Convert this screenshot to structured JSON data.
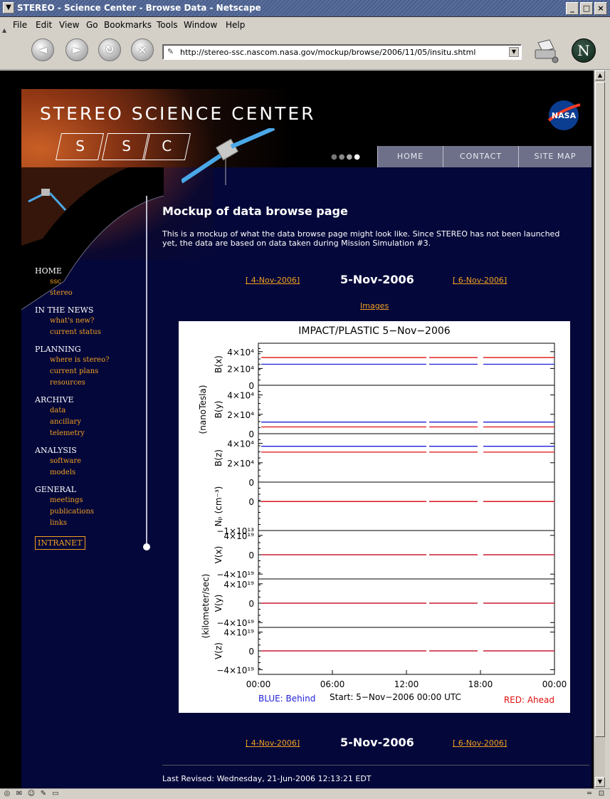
{
  "window": {
    "title": "STEREO - Science Center - Browse Data - Netscape"
  },
  "menu": [
    "File",
    "Edit",
    "View",
    "Go",
    "Bookmarks",
    "Tools",
    "Window",
    "Help"
  ],
  "toolbar": {
    "url": "http://stereo-ssc.nascom.nasa.gov/mockup/browse/2006/11/05/insitu.shtml"
  },
  "banner": {
    "title": "STEREO SCIENCE CENTER",
    "letters": [
      "S",
      "S",
      "C"
    ],
    "nasa": "NASA",
    "nav": [
      "HOME",
      "CONTACT",
      "SITE MAP"
    ]
  },
  "sidebar": {
    "groups": [
      {
        "label": "HOME",
        "items": [
          "ssc",
          "stereo"
        ]
      },
      {
        "label": "IN THE NEWS",
        "items": [
          "what's new?",
          "current status"
        ]
      },
      {
        "label": "PLANNING",
        "items": [
          "where is stereo?",
          "current plans",
          "resources"
        ]
      },
      {
        "label": "ARCHIVE",
        "items": [
          "data",
          "ancillary",
          "telemetry"
        ]
      },
      {
        "label": "ANALYSIS",
        "items": [
          "software",
          "models"
        ]
      },
      {
        "label": "GENERAL",
        "items": [
          "meetings",
          "publications",
          "links"
        ]
      }
    ],
    "intranet": "INTRANET"
  },
  "main": {
    "heading": "Mockup of data browse page",
    "intro": "This is a mockup of what the data browse page might look like. Since STEREO has not been launched yet, the data are based on data taken during Mission Simulation #3.",
    "prev_date": "[ 4-Nov-2006]",
    "current_date": "5-Nov-2006",
    "next_date": "[ 6-Nov-2006]",
    "images_link": "Images",
    "last_revised": "Last Revised: Wednesday, 21-Jun-2006 12:13:21 EDT"
  },
  "chart_data": {
    "type": "line",
    "title": "IMPACT/PLASTIC    5−Nov−2006",
    "x_ticks": [
      "00:00",
      "06:00",
      "12:00",
      "18:00",
      "00:00"
    ],
    "footer_left": "BLUE: Behind",
    "footer_mid": "Start:  5−Nov−2006 00:00 UTC",
    "footer_right": "RED: Ahead",
    "group_labels": [
      "(nanoTesla)",
      "(kilometer/sec)"
    ],
    "panels": [
      {
        "ylabel": "B(x)",
        "ticks": [
          "4×10⁴",
          "2×10⁴",
          "0"
        ],
        "ylim": [
          0,
          50000
        ],
        "series": [
          {
            "name": "Behind",
            "color": "#1f1fd6",
            "value": 25000
          },
          {
            "name": "Ahead",
            "color": "#e01010",
            "value": 33000
          }
        ]
      },
      {
        "ylabel": "B(y)",
        "ticks": [
          "4×10⁴",
          "2×10⁴",
          "0"
        ],
        "ylim": [
          0,
          50000
        ],
        "series": [
          {
            "name": "Behind",
            "color": "#1f1fd6",
            "value": 12000
          },
          {
            "name": "Ahead",
            "color": "#e01010",
            "value": 7000
          }
        ]
      },
      {
        "ylabel": "B(z)",
        "ticks": [
          "4×10⁴",
          "2×10⁴",
          "0"
        ],
        "ylim": [
          0,
          50000
        ],
        "series": [
          {
            "name": "Behind",
            "color": "#1f1fd6",
            "value": 37000
          },
          {
            "name": "Ahead",
            "color": "#e01010",
            "value": 31000
          }
        ]
      },
      {
        "ylabel": "Nₚ (cm⁻³)",
        "ticks": [
          "0",
          "−1×10¹³"
        ],
        "ylim": [
          -15000000000000,
          10000000000000
        ],
        "series": [
          {
            "name": "Behind",
            "color": "#1f1fd6",
            "value": 0
          },
          {
            "name": "Ahead",
            "color": "#e01010",
            "value": 0
          }
        ]
      },
      {
        "ylabel": "V(x)",
        "ticks": [
          "4×10¹⁹",
          "0",
          "−4×10¹⁹"
        ],
        "ylim": [
          -50000000000000000000,
          50000000000000000000
        ],
        "series": [
          {
            "name": "Behind",
            "color": "#1f1fd6",
            "value": 0
          },
          {
            "name": "Ahead",
            "color": "#e01010",
            "value": 0
          }
        ]
      },
      {
        "ylabel": "V(y)",
        "ticks": [
          "4×10¹⁹",
          "0",
          "−4×10¹⁹"
        ],
        "ylim": [
          -50000000000000000000,
          50000000000000000000
        ],
        "series": [
          {
            "name": "Behind",
            "color": "#1f1fd6",
            "value": 0
          },
          {
            "name": "Ahead",
            "color": "#e01010",
            "value": 0
          }
        ]
      },
      {
        "ylabel": "V(z)",
        "ticks": [
          "4×10¹⁹",
          "0",
          "−4×10¹⁹"
        ],
        "ylim": [
          -50000000000000000000,
          50000000000000000000
        ],
        "series": [
          {
            "name": "Behind",
            "color": "#1f1fd6",
            "value": 0
          },
          {
            "name": "Ahead",
            "color": "#e01010",
            "value": 0
          }
        ]
      }
    ]
  }
}
